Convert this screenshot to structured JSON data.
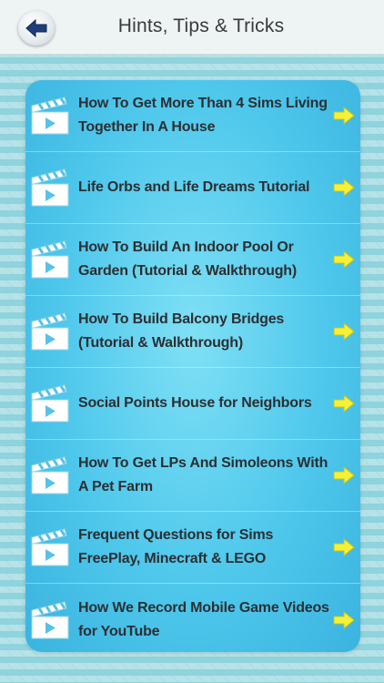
{
  "header": {
    "title": "Hints, Tips & Tricks",
    "back_icon": "back-arrow-icon"
  },
  "colors": {
    "panel": "#4fc8ec",
    "arrow": "#f4f13a",
    "text": "#2c2f33"
  },
  "list": {
    "items": [
      {
        "label": "How To Get More Than 4 Sims Living Together In A House"
      },
      {
        "label": "Life Orbs and Life Dreams Tutorial"
      },
      {
        "label": "How To Build An Indoor Pool Or Garden (Tutorial & Walkthrough)"
      },
      {
        "label": "How To Build Balcony Bridges (Tutorial & Walkthrough)"
      },
      {
        "label": "Social Points House for Neighbors"
      },
      {
        "label": "How To Get LPs And Simoleons With A Pet Farm"
      },
      {
        "label": "Frequent Questions for Sims FreePlay, Minecraft & LEGO"
      },
      {
        "label": "How We Record Mobile Game Videos for YouTube"
      }
    ]
  }
}
